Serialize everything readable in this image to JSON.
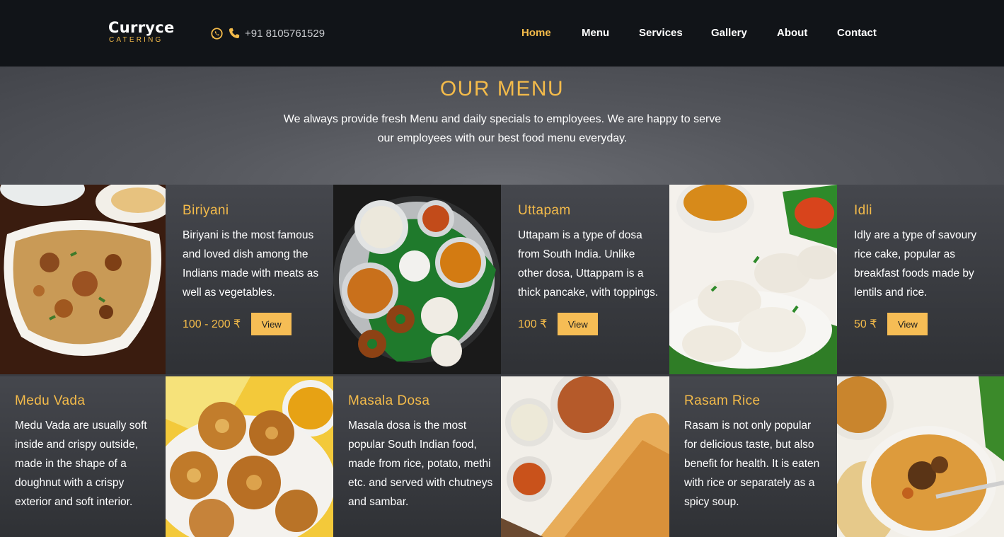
{
  "header": {
    "logo_main": "Curryce",
    "logo_sub": "CATERING",
    "phone": "+91 8105761529"
  },
  "nav": [
    {
      "label": "Home",
      "active": true
    },
    {
      "label": "Menu",
      "active": false
    },
    {
      "label": "Services",
      "active": false
    },
    {
      "label": "Gallery",
      "active": false
    },
    {
      "label": "About",
      "active": false
    },
    {
      "label": "Contact",
      "active": false
    }
  ],
  "hero": {
    "title": "OUR MENU",
    "text": "We always provide fresh Menu and daily specials to employees. We are happy to serve our employees with our best food menu everyday."
  },
  "dishes": [
    {
      "title": "Biriyani",
      "desc": "Biriyani is the most famous and loved dish among the Indians made with meats as well as vegetables.",
      "price": "100 - 200 ₹",
      "button": "View",
      "image_icon": "biriyani-plate"
    },
    {
      "title": "Uttapam",
      "desc": "Uttapam is a type of dosa from South India. Unlike other dosa, Uttappam is a thick pancake, with toppings.",
      "price": "100 ₹",
      "button": "View",
      "image_icon": "south-indian-platter"
    },
    {
      "title": "Idli",
      "desc": "Idly are a type of savoury rice cake, popular as breakfast foods made by lentils and rice.",
      "price": "50 ₹",
      "button": "View",
      "image_icon": "idli-plate"
    },
    {
      "title": "Medu Vada",
      "desc": "Medu Vada are usually soft inside and crispy outside, made in the shape of a doughnut with a crispy exterior and soft interior.",
      "image_icon": "medu-vada-bowl"
    },
    {
      "title": "Masala Dosa",
      "desc": "Masala dosa is the most popular South Indian food, made from rice, potato, methi etc. and served with chutneys and sambar.",
      "image_icon": "masala-dosa-plate"
    },
    {
      "title": "Rasam Rice",
      "desc": "Rasam is not only popular for delicious taste, but also benefit for health. It is eaten with rice or separately as a spicy soup.",
      "image_icon": "rasam-rice-bowl"
    }
  ],
  "colors": {
    "accent": "#f4bb4a",
    "header_bg": "#111418",
    "button_bg": "#f6bd55"
  }
}
